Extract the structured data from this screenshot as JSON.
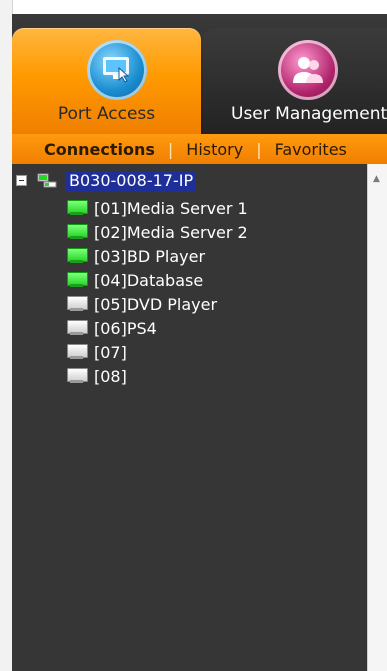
{
  "tabs": {
    "port_access": {
      "label": "Port Access",
      "icon": "port-access-icon"
    },
    "user_management": {
      "label": "User Management",
      "icon": "user-management-icon"
    }
  },
  "subtabs": [
    {
      "label": "Connections",
      "active": true
    },
    {
      "label": "History",
      "active": false
    },
    {
      "label": "Favorites",
      "active": false
    }
  ],
  "tree": {
    "root": {
      "label": "B030-008-17-IP",
      "expanded": true,
      "selected": true
    },
    "ports": [
      {
        "label": "[01]Media Server 1",
        "status": "online"
      },
      {
        "label": "[02]Media Server 2",
        "status": "online"
      },
      {
        "label": "[03]BD Player",
        "status": "online"
      },
      {
        "label": "[04]Database",
        "status": "online"
      },
      {
        "label": "[05]DVD Player",
        "status": "offline"
      },
      {
        "label": "[06]PS4",
        "status": "offline"
      },
      {
        "label": "[07]",
        "status": "offline"
      },
      {
        "label": "[08]",
        "status": "offline"
      }
    ]
  },
  "colors": {
    "accent_orange": "#ff9a00",
    "panel_dark": "#363636",
    "selection_blue": "#1e2f9a",
    "online_green": "#26d826",
    "offline_gray": "#cfcfcf"
  }
}
